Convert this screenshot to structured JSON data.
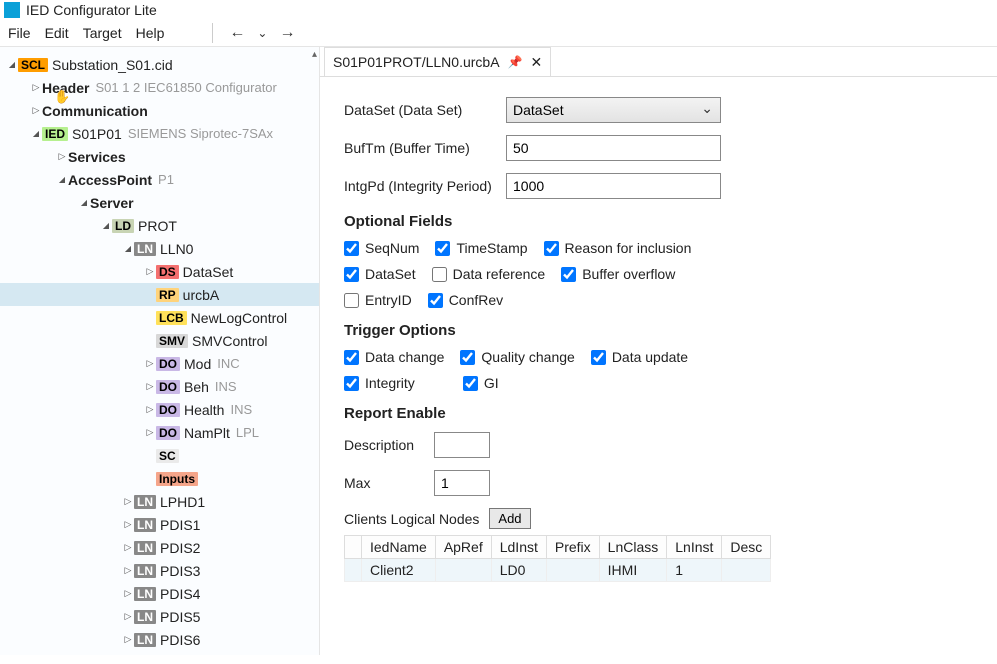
{
  "app": {
    "title": "IED Configurator Lite"
  },
  "menu": {
    "file": "File",
    "edit": "Edit",
    "target": "Target",
    "help": "Help"
  },
  "nav": {
    "back": "←",
    "fwd": "→",
    "down": "⌄"
  },
  "tree": {
    "root": {
      "tag": "SCL",
      "label": "Substation_S01.cid"
    },
    "header": {
      "label": "Header",
      "sub": "S01 1 2 IEC61850 Configurator"
    },
    "comm": {
      "label": "Communication"
    },
    "ied": {
      "tag": "IED",
      "label": "S01P01",
      "sub": "SIEMENS Siprotec-7SAx"
    },
    "services": {
      "label": "Services"
    },
    "ap": {
      "label": "AccessPoint",
      "sub": "P1"
    },
    "server": {
      "label": "Server"
    },
    "ld": {
      "tag": "LD",
      "label": "PROT"
    },
    "ln0": {
      "tag": "LN",
      "label": "LLN0"
    },
    "ds": {
      "tag": "DS",
      "label": "DataSet"
    },
    "rp": {
      "tag": "RP",
      "label": "urcbA"
    },
    "lcb": {
      "tag": "LCB",
      "label": "NewLogControl"
    },
    "smv": {
      "tag": "SMV",
      "label": "SMVControl"
    },
    "do_mod": {
      "tag": "DO",
      "label": "Mod",
      "sub": "INC"
    },
    "do_beh": {
      "tag": "DO",
      "label": "Beh",
      "sub": "INS"
    },
    "do_health": {
      "tag": "DO",
      "label": "Health",
      "sub": "INS"
    },
    "do_namplt": {
      "tag": "DO",
      "label": "NamPlt",
      "sub": "LPL"
    },
    "sc": {
      "tag": "SC",
      "label": ""
    },
    "inputs": {
      "tag": "Inputs",
      "label": ""
    },
    "ln_lphd1": {
      "tag": "LN",
      "label": "LPHD1"
    },
    "ln_pdis1": {
      "tag": "LN",
      "label": "PDIS1"
    },
    "ln_pdis2": {
      "tag": "LN",
      "label": "PDIS2"
    },
    "ln_pdis3": {
      "tag": "LN",
      "label": "PDIS3"
    },
    "ln_pdis4": {
      "tag": "LN",
      "label": "PDIS4"
    },
    "ln_pdis5": {
      "tag": "LN",
      "label": "PDIS5"
    },
    "ln_pdis6": {
      "tag": "LN",
      "label": "PDIS6"
    }
  },
  "tab": {
    "title": "S01P01PROT/LLN0.urcbA"
  },
  "form": {
    "dataset_lbl": "DataSet (Data Set)",
    "dataset_val": "DataSet",
    "buftm_lbl": "BufTm (Buffer Time)",
    "buftm_val": "50",
    "intgpd_lbl": "IntgPd (Integrity Period)",
    "intgpd_val": "1000"
  },
  "opt": {
    "heading": "Optional Fields",
    "seqnum": "SeqNum",
    "timestamp": "TimeStamp",
    "reason": "Reason for inclusion",
    "dataset": "DataSet",
    "dataref": "Data reference",
    "bufovfl": "Buffer overflow",
    "entryid": "EntryID",
    "confrev": "ConfRev"
  },
  "trg": {
    "heading": "Trigger Options",
    "dchg": "Data change",
    "qchg": "Quality change",
    "dupd": "Data update",
    "integrity": "Integrity",
    "gi": "GI"
  },
  "rpt": {
    "heading": "Report Enable",
    "desc_lbl": "Description",
    "desc_val": "",
    "max_lbl": "Max",
    "max_val": "1",
    "clients_lbl": "Clients Logical Nodes",
    "add": "Add"
  },
  "table": {
    "h_ied": "IedName",
    "h_ap": "ApRef",
    "h_ld": "LdInst",
    "h_pre": "Prefix",
    "h_lnc": "LnClass",
    "h_lni": "LnInst",
    "h_desc": "Desc",
    "r0_ied": "Client2",
    "r0_ap": "",
    "r0_ld": "LD0",
    "r0_pre": "",
    "r0_lnc": "IHMI",
    "r0_lni": "1",
    "r0_desc": ""
  }
}
